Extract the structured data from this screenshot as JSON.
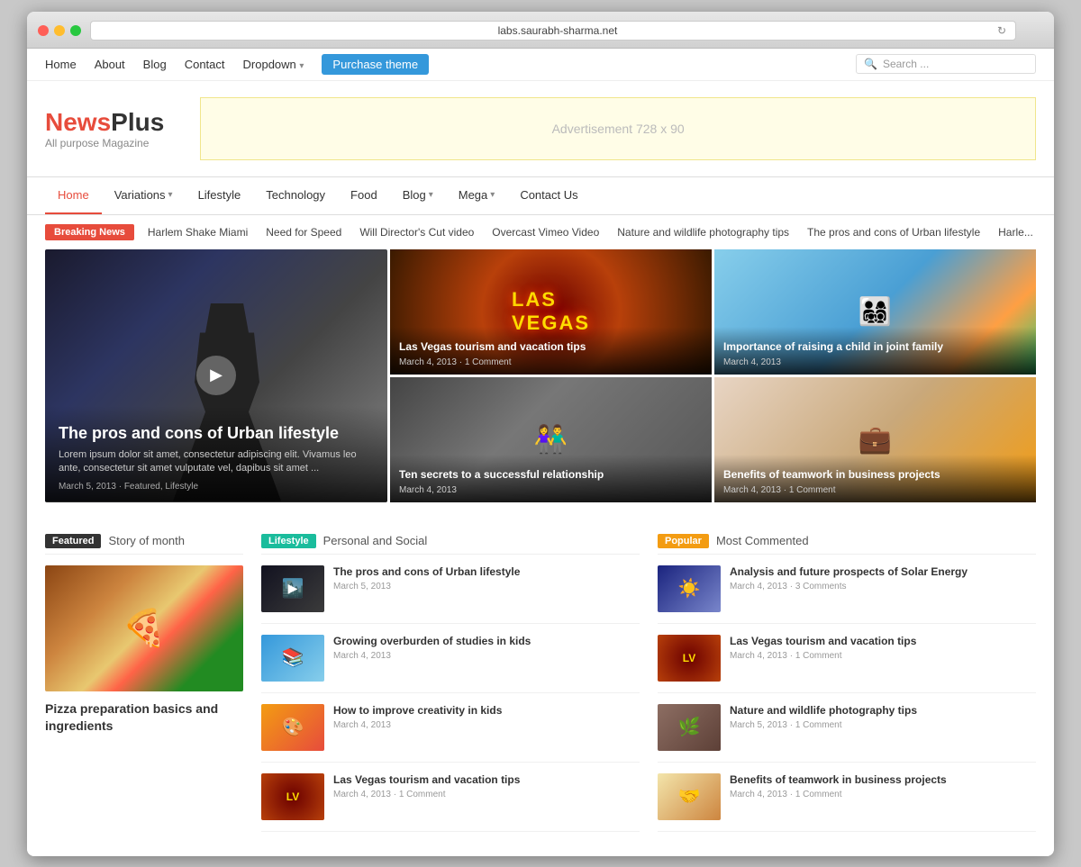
{
  "browser": {
    "url": "labs.saurabh-sharma.net",
    "reload_icon": "↻"
  },
  "top_nav": {
    "items": [
      "Home",
      "About",
      "Blog",
      "Contact",
      "Dropdown"
    ],
    "purchase_label": "Purchase theme",
    "search_placeholder": "Search ..."
  },
  "logo": {
    "news": "News",
    "plus": "Plus",
    "tagline": "All purpose Magazine"
  },
  "ad": {
    "text": "Advertisement 728 x 90"
  },
  "main_nav": {
    "items": [
      {
        "label": "Home",
        "active": true
      },
      {
        "label": "Variations",
        "dropdown": true
      },
      {
        "label": "Lifestyle"
      },
      {
        "label": "Technology"
      },
      {
        "label": "Food"
      },
      {
        "label": "Blog",
        "dropdown": true
      },
      {
        "label": "Mega",
        "dropdown": true
      },
      {
        "label": "Contact Us"
      }
    ]
  },
  "breaking_news": {
    "badge": "Breaking News",
    "items": [
      "Harlem Shake Miami",
      "Need for Speed",
      "Will Director's Cut video",
      "Overcast Vimeo Video",
      "Nature and wildlife photography tips",
      "The pros and cons of Urban lifestyle",
      "Harle..."
    ]
  },
  "hero": {
    "main": {
      "title": "The pros and cons of Urban lifestyle",
      "excerpt": "Lorem ipsum dolor sit amet, consectetur adipiscing elit. Vivamus leo ante, consectetur sit amet vulputate vel, dapibus sit amet ...",
      "meta": "March 5, 2013 · Featured, Lifestyle"
    },
    "top_right_1": {
      "title": "Las Vegas tourism and vacation tips",
      "meta": "March 4, 2013 · 1 Comment"
    },
    "top_right_2": {
      "title": "Importance of raising a child in joint family",
      "meta": "March 4, 2013"
    },
    "bottom_right_1": {
      "title": "Ten secrets to a successful relationship",
      "meta": "March 4, 2013"
    },
    "bottom_right_2": {
      "title": "Benefits of teamwork in business projects",
      "meta": "March 4, 2013 · 1 Comment"
    }
  },
  "featured_section": {
    "badge": "Featured",
    "subtitle": "Story of month",
    "image_emoji": "🍕",
    "title": "Pizza preparation basics and ingredients"
  },
  "lifestyle_section": {
    "badge": "Lifestyle",
    "subtitle": "Personal and Social",
    "articles": [
      {
        "title": "The pros and cons of Urban lifestyle",
        "meta": "March 5, 2013",
        "has_play": true
      },
      {
        "title": "Growing overburden of studies in kids",
        "meta": "March 4, 2013",
        "has_play": false
      },
      {
        "title": "How to improve creativity in kids",
        "meta": "March 4, 2013",
        "has_play": false
      },
      {
        "title": "Las Vegas tourism and vacation tips",
        "meta": "March 4, 2013 · 1 Comment",
        "has_play": false
      }
    ]
  },
  "popular_section": {
    "badge": "Popular",
    "subtitle": "Most Commented",
    "articles": [
      {
        "title": "Analysis and future prospects of Solar Energy",
        "meta": "March 4, 2013 · 3 Comments"
      },
      {
        "title": "Las Vegas tourism and vacation tips",
        "meta": "March 4, 2013 · 1 Comment"
      },
      {
        "title": "Nature and wildlife photography tips",
        "meta": "March 5, 2013 · 1 Comment"
      },
      {
        "title": "Benefits of teamwork in business projects",
        "meta": "March 4, 2013 · 1 Comment"
      }
    ]
  }
}
